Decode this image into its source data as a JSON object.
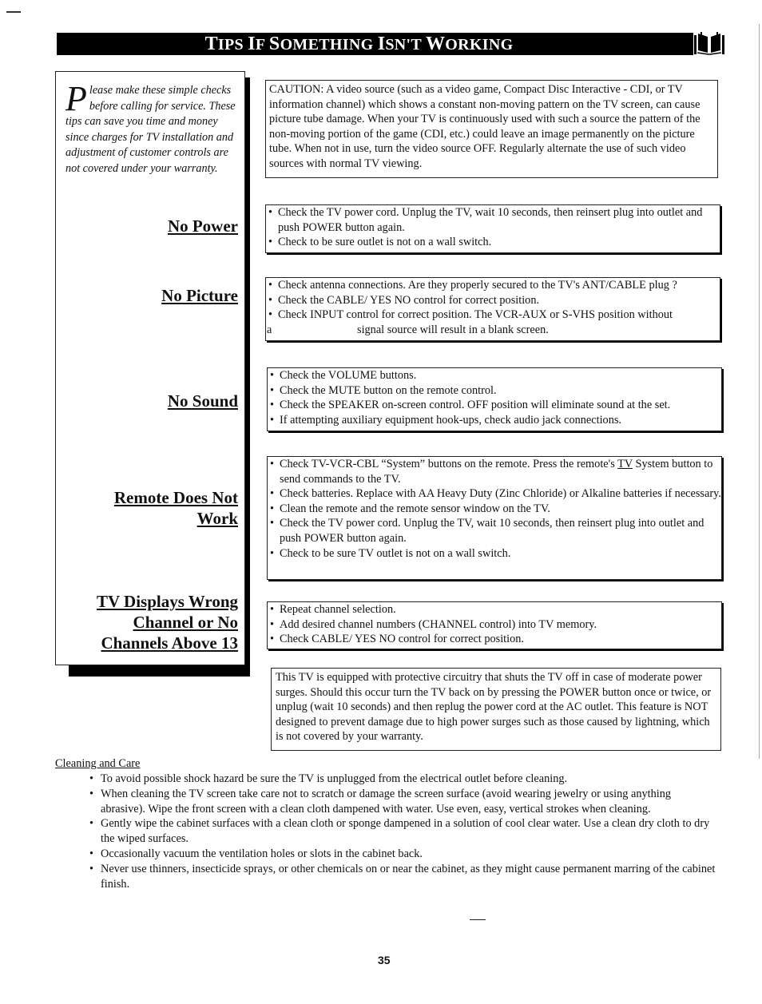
{
  "page": {
    "title": "Tips If Something Isn't Working",
    "title_parts": [
      {
        "cap": "T",
        "rest": "IPS "
      },
      {
        "cap": "I",
        "rest": "F "
      },
      {
        "cap": "S",
        "rest": "OMETHING "
      },
      {
        "cap": "I",
        "rest": "SN'T "
      },
      {
        "cap": "W",
        "rest": "ORKING"
      }
    ],
    "icon": "open-book-icon",
    "page_number": "35"
  },
  "sidebar": {
    "intro_dropcap": "P",
    "intro_text": "lease make these simple checks before calling for service.  These tips can save you time and money since charges for TV installation and adjustment of customer controls are not covered under your warranty.",
    "headings": [
      {
        "id": "no-power",
        "label": "No Power"
      },
      {
        "id": "no-picture",
        "label": "No Picture"
      },
      {
        "id": "no-sound",
        "label": "No Sound"
      },
      {
        "id": "remote",
        "label_line1": "Remote Does Not",
        "label_line2": "Work"
      },
      {
        "id": "wrong-channel",
        "label_line1": "TV Displays Wrong",
        "label_line2": "Channel or No",
        "label_line3": "Channels Above 13"
      }
    ]
  },
  "caution": {
    "text": "CAUTION: A video source (such as a video game, Compact Disc Interactive - CDI, or TV information channel) which shows a constant non-moving pattern on the TV screen, can cause picture tube damage.  When your TV is continuously used with such a source the pattern of the non-moving portion of the game (CDI, etc.) could leave an image permanently on the picture tube.  When not in use, turn the video source OFF. Regularly alternate the use of such video sources with normal TV viewing."
  },
  "sections": {
    "no_power": [
      "Check the TV power cord.  Unplug the TV, wait 10 seconds, then reinsert plug into outlet and push POWER button again.",
      "Check to be sure outlet is not on a wall switch."
    ],
    "no_picture": [
      "Check antenna connections.  Are they properly secured to the TV's ANT/CABLE plug ?",
      "Check the CABLE/ YES  NO control for correct position.",
      "Check INPUT control for correct position.  The VCR-AUX or S-VHS position without"
    ],
    "no_picture_continuation_prefix": "a",
    "no_picture_continuation": "signal source will result in a blank screen.",
    "no_sound": [
      "Check the VOLUME buttons.",
      "Check the MUTE button on the remote control.",
      "Check the SPEAKER on-screen control. OFF position will eliminate sound at the set.",
      "If attempting auxiliary equipment hook-ups, check audio jack connections."
    ],
    "remote": {
      "item1_before": "Check TV-VCR-CBL “System” buttons on the remote.  Press the remote's ",
      "item1_underlined": "TV",
      "item1_after": " System button to send commands to the TV.",
      "items": [
        "Check batteries.  Replace with AA Heavy Duty (Zinc Chloride) or Alkaline batteries if necessary.",
        "Clean the remote and the remote sensor window on the TV.",
        "Check the TV power cord.  Unplug the TV, wait 10 seconds, then reinsert plug into outlet and push POWER button again.",
        "Check to be sure TV outlet is not on a wall switch."
      ]
    },
    "wrong_channel": [
      "Repeat channel selection.",
      "Add desired channel numbers (CHANNEL control) into TV memory.",
      "Check CABLE/  YES  NO control for correct position."
    ]
  },
  "surge_note": {
    "text": "This TV is equipped with protective circuitry that shuts the TV off in case of moderate power surges.  Should this occur turn the TV back on by pressing the POWER button once or twice, or unplug (wait 10 seconds) and then replug the power cord at the AC outlet. This feature is NOT designed to prevent damage due to high power surges such as those caused by lightning, which is not covered by your warranty."
  },
  "cleaning": {
    "title": "Cleaning and Care",
    "items": [
      "To avoid possible shock hazard be sure the TV is unplugged from the electrical outlet before cleaning.",
      "When cleaning the TV screen take care not to scratch or damage the screen surface (avoid wearing jewelry or using anything abrasive).  Wipe the front screen with a clean cloth dampened with water.  Use even, easy, vertical strokes when cleaning.",
      "Gently wipe the cabinet surfaces with a clean cloth or sponge dampened in a solution of cool clear water.  Use a clean dry cloth to dry the wiped surfaces.",
      "Occasionally vacuum the ventilation holes or slots in the cabinet back.",
      "Never use thinners, insecticide sprays, or other chemicals on or near the cabinet, as they might cause permanent marring of the cabinet finish."
    ]
  }
}
